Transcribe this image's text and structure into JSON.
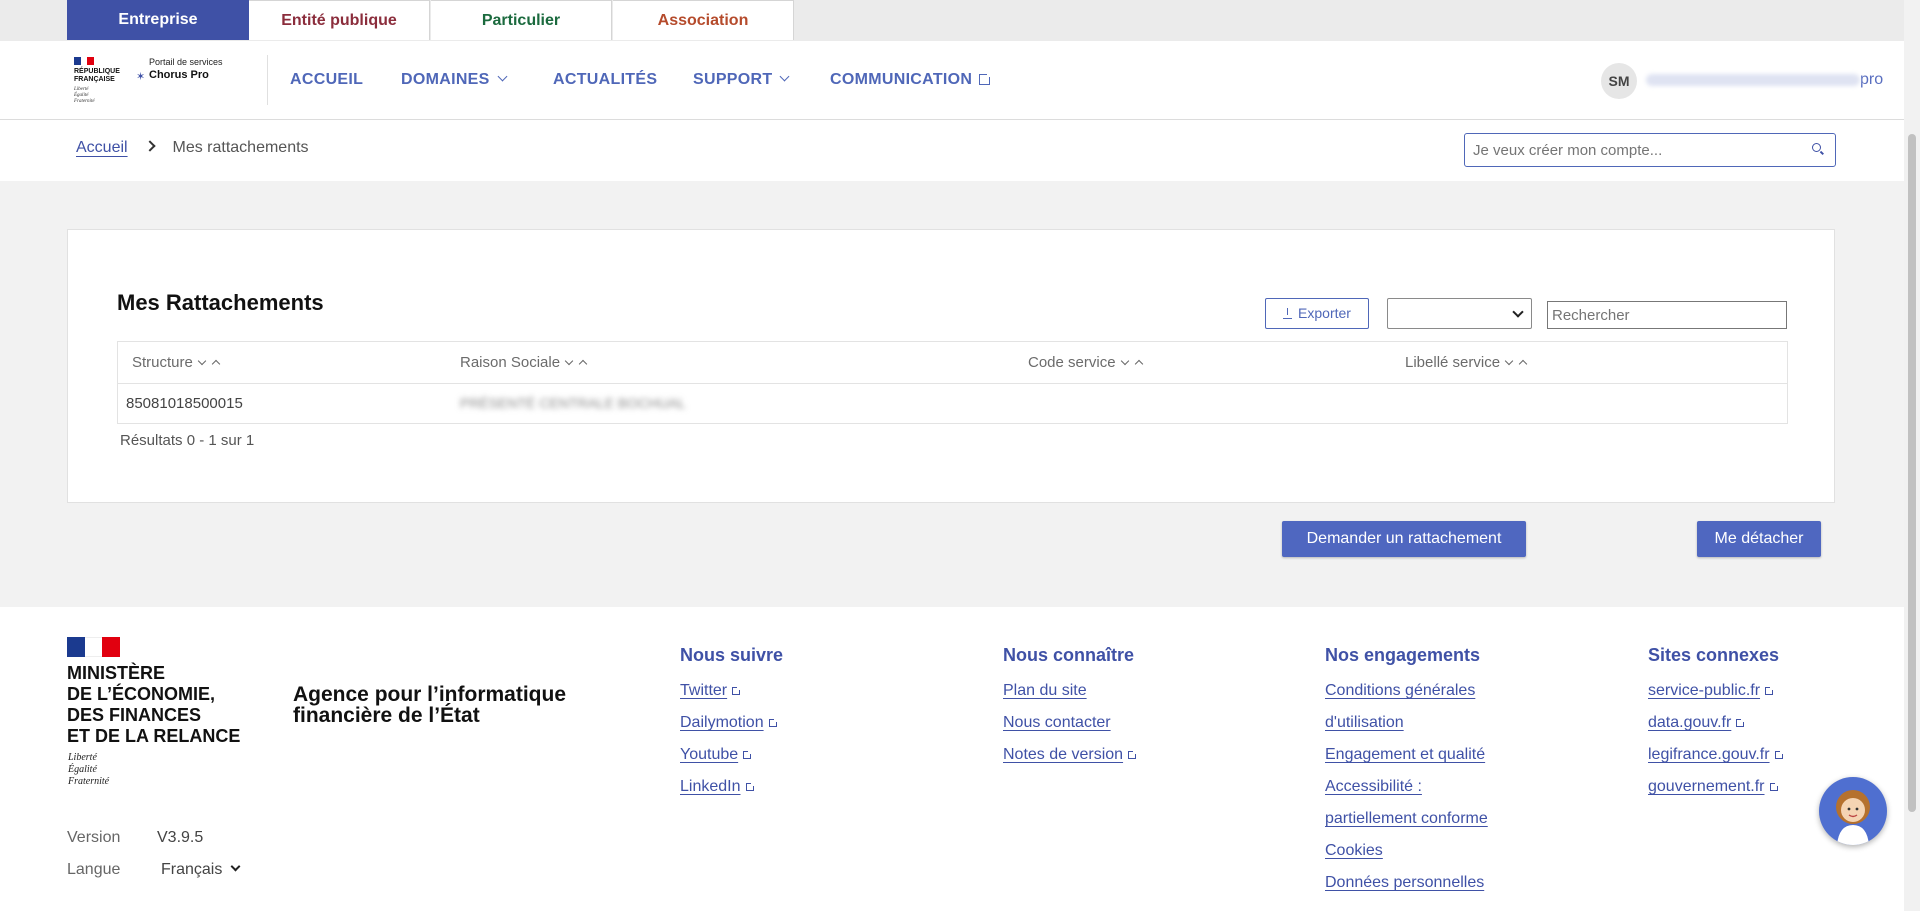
{
  "audience_tabs": [
    {
      "label": "Entreprise",
      "color": "#ffffff",
      "bg": "#3f51a6"
    },
    {
      "label": "Entité publique",
      "color": "#8b2d3c",
      "bg": "#ffffff"
    },
    {
      "label": "Particulier",
      "color": "#1b6a3e",
      "bg": "#ffffff"
    },
    {
      "label": "Association",
      "color": "#b54b2c",
      "bg": "#ffffff"
    }
  ],
  "logo": {
    "republique": "RÉPUBLIQUE\nFRANÇAISE",
    "motto": "Liberté\nÉgalité\nFraternité",
    "portal_sub": "Portail de services",
    "portal_name": "Chorus Pro"
  },
  "nav": {
    "accueil": "ACCUEIL",
    "domaines": "DOMAINES",
    "actualites": "ACTUALITÉS",
    "support": "SUPPORT",
    "communication": "COMMUNICATION"
  },
  "user": {
    "initials": "SM",
    "email_suffix": "pro"
  },
  "breadcrumb": {
    "home": "Accueil",
    "current": "Mes rattachements"
  },
  "search": {
    "placeholder": "Je veux créer mon compte..."
  },
  "card": {
    "title": "Mes Rattachements",
    "export_label": "Exporter",
    "search_placeholder": "Rechercher",
    "columns": [
      "Structure",
      "Raison Sociale",
      "Code service",
      "Libellé service"
    ],
    "rows": [
      {
        "structure": "85081018500015",
        "raison_sociale": "PRÉSENTÉ CENTRALE BOCHUAL",
        "code_service": "",
        "libelle_service": ""
      }
    ],
    "results": "Résultats 0 - 1 sur 1"
  },
  "actions": {
    "request": "Demander un rattachement",
    "detach": "Me détacher"
  },
  "footer": {
    "ministry": [
      "MINISTÈRE",
      "DE L’ÉCONOMIE,",
      "DES FINANCES",
      "ET DE LA RELANCE"
    ],
    "ministry_motto": [
      "Liberté",
      "Égalité",
      "Fraternité"
    ],
    "agency": [
      "Agence pour l’informatique",
      "financière de l’État"
    ],
    "version_label": "Version",
    "version_value": "V3.9.5",
    "language_label": "Langue",
    "language_value": "Français",
    "columns": [
      {
        "title": "Nous suivre",
        "links": [
          {
            "t": "Twitter",
            "ext": true
          },
          {
            "t": "Dailymotion",
            "ext": true
          },
          {
            "t": "Youtube",
            "ext": true
          },
          {
            "t": "LinkedIn",
            "ext": true
          }
        ]
      },
      {
        "title": "Nous connaître",
        "links": [
          {
            "t": "Plan du site",
            "ext": false
          },
          {
            "t": "Nous contacter",
            "ext": false
          },
          {
            "t": "Notes de version",
            "ext": true
          }
        ]
      },
      {
        "title": "Nos engagements",
        "links": [
          {
            "t": "Conditions générales",
            "ext": false
          },
          {
            "t": "d'utilisation",
            "ext": false
          },
          {
            "t": "Engagement et qualité",
            "ext": false
          },
          {
            "t": "Accessibilité :",
            "ext": false
          },
          {
            "t": "partiellement conforme",
            "ext": false
          },
          {
            "t": "Cookies",
            "ext": false
          },
          {
            "t": "Données personnelles",
            "ext": false
          }
        ]
      },
      {
        "title": "Sites connexes",
        "links": [
          {
            "t": "service-public.fr",
            "ext": true
          },
          {
            "t": "data.gouv.fr",
            "ext": true
          },
          {
            "t": "legifrance.gouv.fr",
            "ext": true
          },
          {
            "t": "gouvernement.fr",
            "ext": true
          }
        ]
      }
    ]
  },
  "chat_icon": "assistant-avatar-icon"
}
